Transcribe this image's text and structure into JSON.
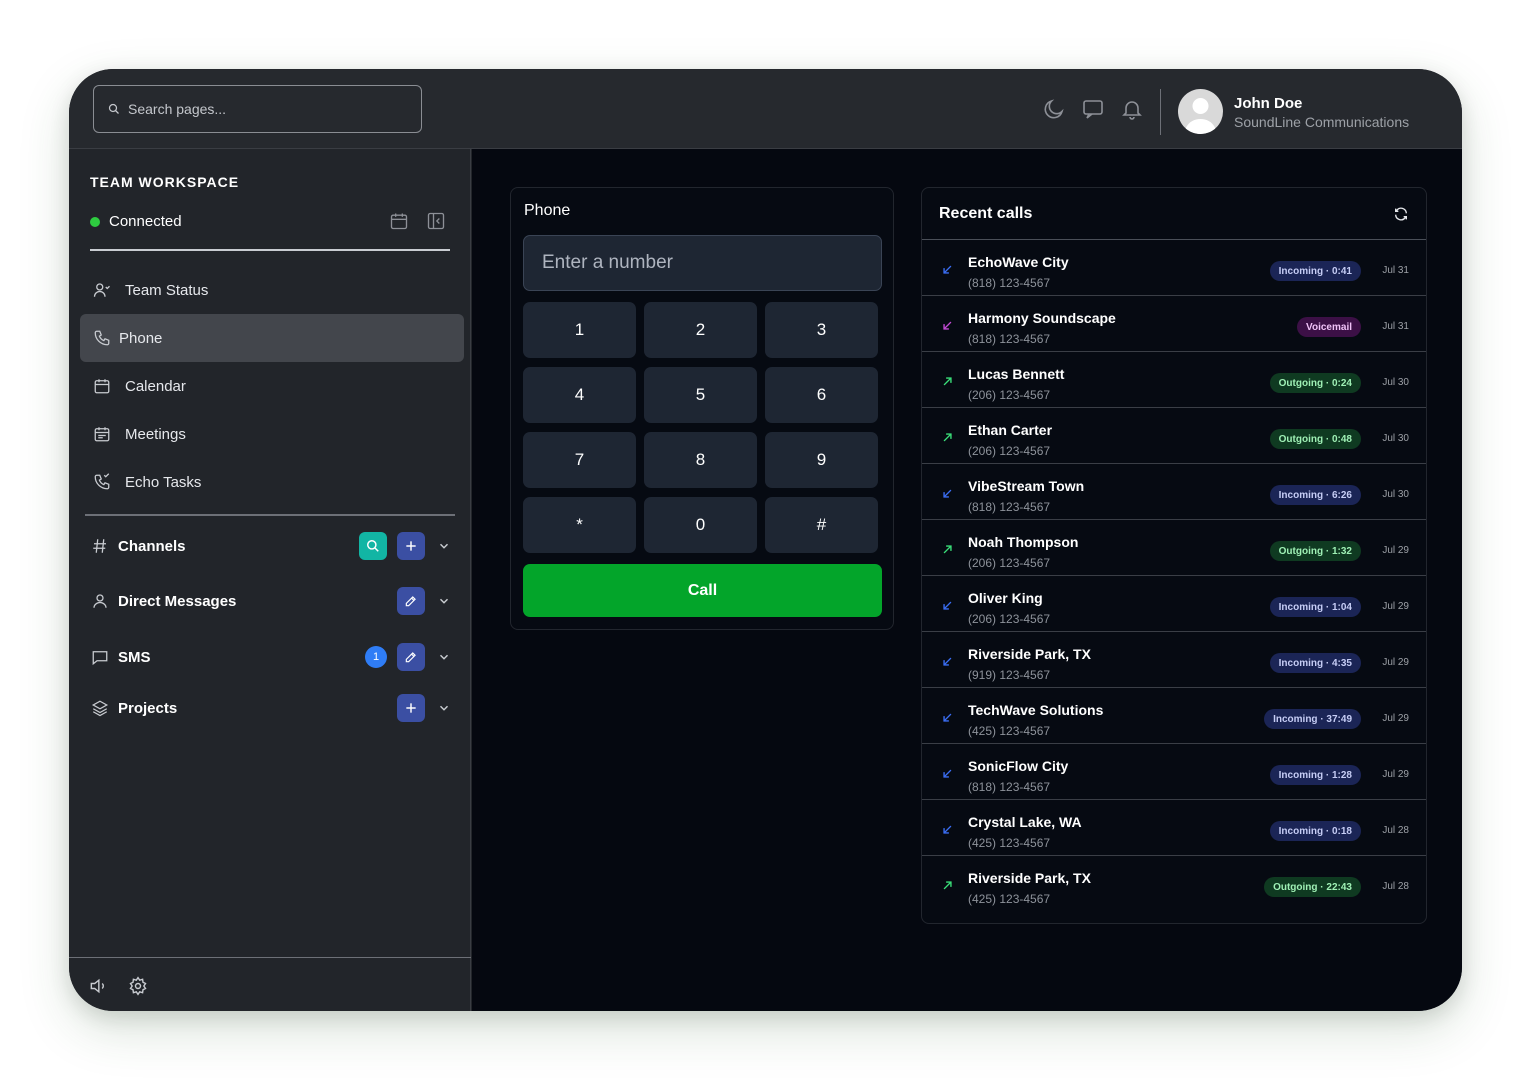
{
  "search": {
    "placeholder": "Search pages..."
  },
  "user": {
    "name": "John Doe",
    "company": "SoundLine Communications"
  },
  "workspace": {
    "title": "TEAM WORKSPACE",
    "status": "Connected"
  },
  "nav": [
    {
      "label": "Team Status",
      "icon": "team-icon"
    },
    {
      "label": "Phone",
      "icon": "phone-icon",
      "active": true
    },
    {
      "label": "Calendar",
      "icon": "calendar-icon"
    },
    {
      "label": "Meetings",
      "icon": "meetings-icon"
    },
    {
      "label": "Echo Tasks",
      "icon": "phone-task-icon"
    }
  ],
  "sections": {
    "channels": "Channels",
    "direct_messages": "Direct Messages",
    "sms": "SMS",
    "sms_badge": "1",
    "projects": "Projects"
  },
  "phone": {
    "title": "Phone",
    "placeholder": "Enter a number",
    "keys": [
      "1",
      "2",
      "3",
      "4",
      "5",
      "6",
      "7",
      "8",
      "9",
      "*",
      "0",
      "#"
    ],
    "call_label": "Call"
  },
  "recent": {
    "title": "Recent calls",
    "calls": [
      {
        "name": "EchoWave City",
        "number": "(818) 123-4567",
        "type": "in",
        "status": "Incoming · 0:41",
        "date": "Jul 31"
      },
      {
        "name": "Harmony Soundscape",
        "number": "(818) 123-4567",
        "type": "vm",
        "status": "Voicemail",
        "date": "Jul 31"
      },
      {
        "name": "Lucas Bennett",
        "number": "(206) 123-4567",
        "type": "out",
        "status": "Outgoing · 0:24",
        "date": "Jul 30"
      },
      {
        "name": "Ethan Carter",
        "number": "(206) 123-4567",
        "type": "out",
        "status": "Outgoing · 0:48",
        "date": "Jul 30"
      },
      {
        "name": "VibeStream Town",
        "number": "(818) 123-4567",
        "type": "in",
        "status": "Incoming · 6:26",
        "date": "Jul 30"
      },
      {
        "name": "Noah Thompson",
        "number": "(206) 123-4567",
        "type": "out",
        "status": "Outgoing · 1:32",
        "date": "Jul 29"
      },
      {
        "name": "Oliver King",
        "number": "(206) 123-4567",
        "type": "in",
        "status": "Incoming · 1:04",
        "date": "Jul 29"
      },
      {
        "name": "Riverside Park, TX",
        "number": "(919) 123-4567",
        "type": "in",
        "status": "Incoming · 4:35",
        "date": "Jul 29"
      },
      {
        "name": "TechWave Solutions",
        "number": "(425) 123-4567",
        "type": "in",
        "status": "Incoming · 37:49",
        "date": "Jul 29"
      },
      {
        "name": "SonicFlow City",
        "number": "(818) 123-4567",
        "type": "in",
        "status": "Incoming · 1:28",
        "date": "Jul 29"
      },
      {
        "name": "Crystal Lake, WA",
        "number": "(425) 123-4567",
        "type": "in",
        "status": "Incoming · 0:18",
        "date": "Jul 28"
      },
      {
        "name": "Riverside Park, TX",
        "number": "(425) 123-4567",
        "type": "out",
        "status": "Outgoing · 22:43",
        "date": "Jul 28"
      }
    ]
  },
  "colors": {
    "incoming": "#3b6ef5",
    "outgoing": "#3be07a",
    "voicemail": "#c44bd6",
    "call_button": "#03a52a"
  }
}
